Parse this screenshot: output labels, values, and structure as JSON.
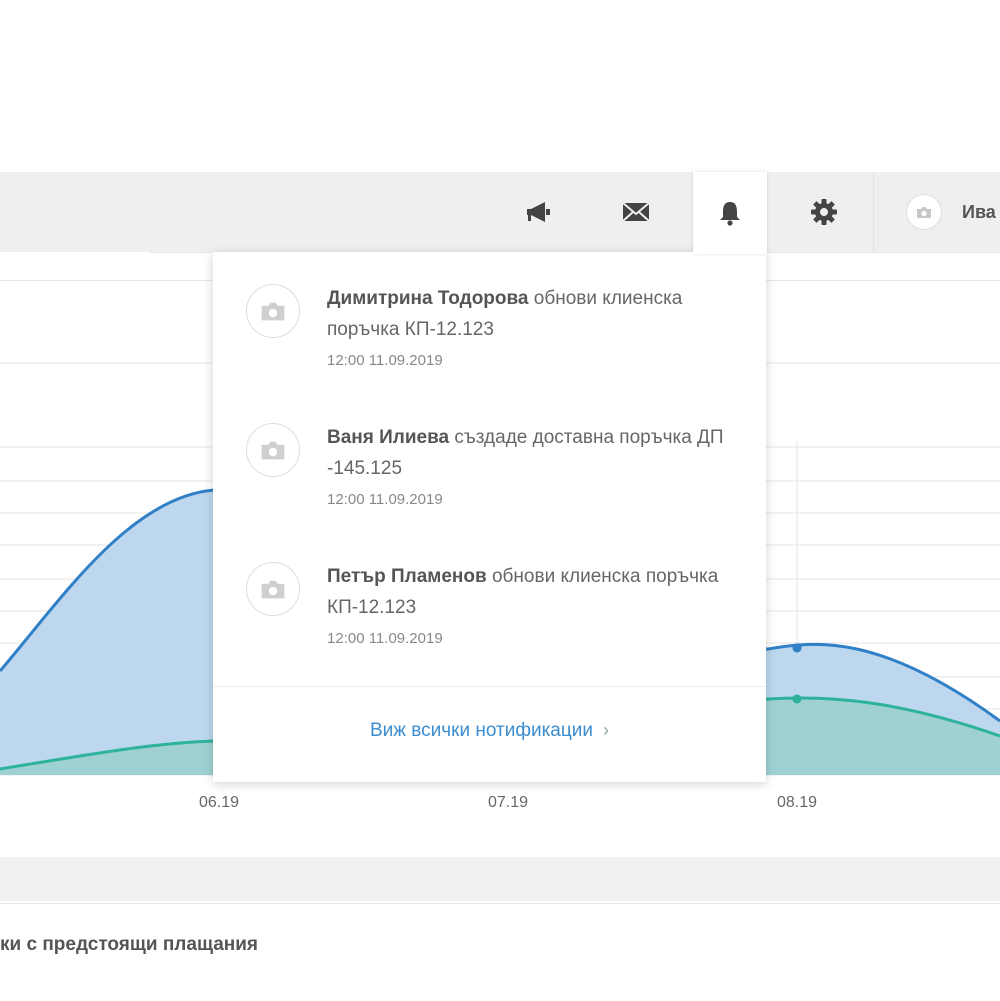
{
  "header": {
    "user_name": "Ива",
    "icons": {
      "announce": "megaphone-icon",
      "mail": "envelope-icon",
      "bell": "bell-icon",
      "settings": "gear-icon",
      "avatar": "camera-icon"
    }
  },
  "notifications": {
    "items": [
      {
        "author": "Димитрина Тодорова",
        "action": " обнови клиенска поръчка КП-12.123",
        "time": "12:00 11.09.2019"
      },
      {
        "author": "Ваня Илиева",
        "action": " създаде доставна поръчка ДП -145.125",
        "time": "12:00 11.09.2019"
      },
      {
        "author": "Петър Пламенов",
        "action": " обнови клиенска поръчка КП-12.123",
        "time": "12:00 11.09.2019"
      }
    ],
    "view_all": "Виж всички нотификации",
    "chevron": "›"
  },
  "section2": {
    "title": "ки с предстоящи плащания"
  },
  "chart_data": {
    "type": "area",
    "x_ticks": [
      "06.19",
      "07.19",
      "08.19"
    ],
    "series": [
      {
        "color": "#3080c8",
        "fill": "#bcd7ee"
      },
      {
        "color": "#2db39b",
        "fill": "#9fd1d3"
      }
    ],
    "grid": true
  },
  "colors": {
    "accent": "#3c8dcf",
    "header_bg": "#efefef"
  }
}
